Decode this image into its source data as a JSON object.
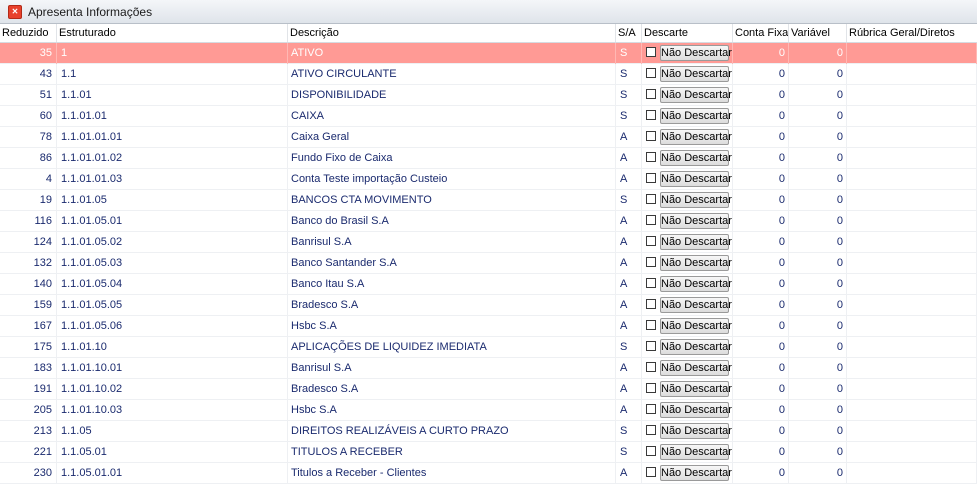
{
  "window": {
    "title": "Apresenta Informações"
  },
  "columns": [
    {
      "key": "reduzido",
      "label": "Reduzido"
    },
    {
      "key": "estruturado",
      "label": "Estruturado"
    },
    {
      "key": "descricao",
      "label": "Descrição"
    },
    {
      "key": "sa",
      "label": "S/A"
    },
    {
      "key": "descarte",
      "label": "Descarte"
    },
    {
      "key": "conta_fixa",
      "label": "Conta Fixa"
    },
    {
      "key": "variavel",
      "label": "Variável"
    },
    {
      "key": "rubrica",
      "label": "Rúbrica Geral/Diretos"
    }
  ],
  "button_label": "Não Descartar",
  "colors": {
    "selected_row": "#ff9a95",
    "text": "#1a2a6e"
  },
  "rows": [
    {
      "reduzido": "35",
      "estruturado": "1",
      "descricao": "ATIVO",
      "sa": "S",
      "conta_fixa": "0",
      "variavel": "0",
      "selected": true
    },
    {
      "reduzido": "43",
      "estruturado": "1.1",
      "descricao": "ATIVO CIRCULANTE",
      "sa": "S",
      "conta_fixa": "0",
      "variavel": "0"
    },
    {
      "reduzido": "51",
      "estruturado": "1.1.01",
      "descricao": "DISPONIBILIDADE",
      "sa": "S",
      "conta_fixa": "0",
      "variavel": "0"
    },
    {
      "reduzido": "60",
      "estruturado": "1.1.01.01",
      "descricao": "CAIXA",
      "sa": "S",
      "conta_fixa": "0",
      "variavel": "0"
    },
    {
      "reduzido": "78",
      "estruturado": "1.1.01.01.01",
      "descricao": "Caixa Geral",
      "sa": "A",
      "conta_fixa": "0",
      "variavel": "0"
    },
    {
      "reduzido": "86",
      "estruturado": "1.1.01.01.02",
      "descricao": "Fundo Fixo de Caixa",
      "sa": "A",
      "conta_fixa": "0",
      "variavel": "0"
    },
    {
      "reduzido": "4",
      "estruturado": "1.1.01.01.03",
      "descricao": "Conta Teste importação Custeio",
      "sa": "A",
      "conta_fixa": "0",
      "variavel": "0"
    },
    {
      "reduzido": "19",
      "estruturado": "1.1.01.05",
      "descricao": "BANCOS CTA MOVIMENTO",
      "sa": "S",
      "conta_fixa": "0",
      "variavel": "0"
    },
    {
      "reduzido": "116",
      "estruturado": "1.1.01.05.01",
      "descricao": "Banco do Brasil S.A",
      "sa": "A",
      "conta_fixa": "0",
      "variavel": "0"
    },
    {
      "reduzido": "124",
      "estruturado": "1.1.01.05.02",
      "descricao": "Banrisul S.A",
      "sa": "A",
      "conta_fixa": "0",
      "variavel": "0"
    },
    {
      "reduzido": "132",
      "estruturado": "1.1.01.05.03",
      "descricao": "Banco Santander S.A",
      "sa": "A",
      "conta_fixa": "0",
      "variavel": "0"
    },
    {
      "reduzido": "140",
      "estruturado": "1.1.01.05.04",
      "descricao": "Banco Itau S.A",
      "sa": "A",
      "conta_fixa": "0",
      "variavel": "0"
    },
    {
      "reduzido": "159",
      "estruturado": "1.1.01.05.05",
      "descricao": "Bradesco S.A",
      "sa": "A",
      "conta_fixa": "0",
      "variavel": "0"
    },
    {
      "reduzido": "167",
      "estruturado": "1.1.01.05.06",
      "descricao": "Hsbc S.A",
      "sa": "A",
      "conta_fixa": "0",
      "variavel": "0"
    },
    {
      "reduzido": "175",
      "estruturado": "1.1.01.10",
      "descricao": "APLICAÇÕES DE LIQUIDEZ IMEDIATA",
      "sa": "S",
      "conta_fixa": "0",
      "variavel": "0"
    },
    {
      "reduzido": "183",
      "estruturado": "1.1.01.10.01",
      "descricao": "Banrisul S.A",
      "sa": "A",
      "conta_fixa": "0",
      "variavel": "0"
    },
    {
      "reduzido": "191",
      "estruturado": "1.1.01.10.02",
      "descricao": "Bradesco S.A",
      "sa": "A",
      "conta_fixa": "0",
      "variavel": "0"
    },
    {
      "reduzido": "205",
      "estruturado": "1.1.01.10.03",
      "descricao": "Hsbc S.A",
      "sa": "A",
      "conta_fixa": "0",
      "variavel": "0"
    },
    {
      "reduzido": "213",
      "estruturado": "1.1.05",
      "descricao": "DIREITOS REALIZÁVEIS A CURTO PRAZO",
      "sa": "S",
      "conta_fixa": "0",
      "variavel": "0"
    },
    {
      "reduzido": "221",
      "estruturado": "1.1.05.01",
      "descricao": "TITULOS A RECEBER",
      "sa": "S",
      "conta_fixa": "0",
      "variavel": "0"
    },
    {
      "reduzido": "230",
      "estruturado": "1.1.05.01.01",
      "descricao": "Titulos a Receber - Clientes",
      "sa": "A",
      "conta_fixa": "0",
      "variavel": "0"
    }
  ]
}
